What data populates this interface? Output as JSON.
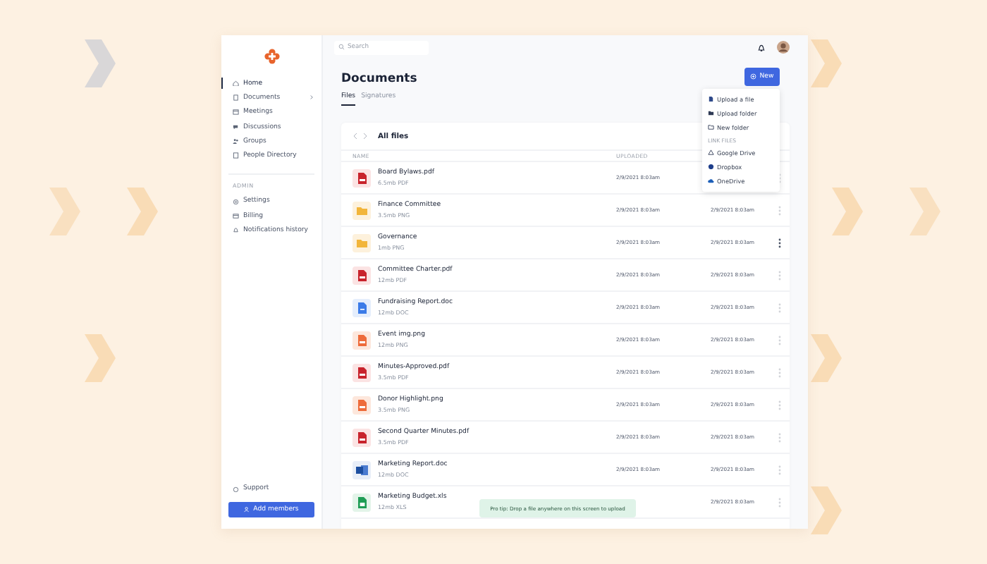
{
  "sidebar": {
    "items": [
      {
        "label": "Home",
        "kind": "home",
        "selected": true,
        "expandable": false
      },
      {
        "label": "Documents",
        "kind": "doc",
        "selected": false,
        "expandable": true
      },
      {
        "label": "Meetings",
        "kind": "calendar",
        "selected": false,
        "expandable": false
      },
      {
        "label": "Discussions",
        "kind": "chat",
        "selected": false,
        "expandable": false
      },
      {
        "label": "Groups",
        "kind": "users",
        "selected": false,
        "expandable": false
      },
      {
        "label": "People Directory",
        "kind": "book",
        "selected": false,
        "expandable": false
      }
    ],
    "section": "ADMIN",
    "admin_items": [
      {
        "label": "Settings",
        "kind": "gear",
        "selected": false
      },
      {
        "label": "Billing",
        "kind": "card",
        "selected": false
      },
      {
        "label": "Notifications history",
        "kind": "bell",
        "selected": false
      }
    ],
    "support": "Support",
    "add_button": "Add members"
  },
  "search": {
    "placeholder": "Search"
  },
  "page_title": "Documents",
  "tabs": [
    {
      "label": "Files",
      "selected": true
    },
    {
      "label": "Signatures",
      "selected": false
    }
  ],
  "new_button": "New",
  "new_menu": {
    "items": [
      {
        "label": "Upload a file",
        "kind": "file"
      },
      {
        "label": "Upload folder",
        "kind": "folder"
      },
      {
        "label": "New folder",
        "kind": "folder-plus"
      }
    ],
    "section": "LINK FILES",
    "links": [
      {
        "label": "Google Drive",
        "kind": "drive"
      },
      {
        "label": "Dropbox",
        "kind": "dropbox"
      },
      {
        "label": "OneDrive",
        "kind": "cloud"
      }
    ]
  },
  "table": {
    "title": "All files",
    "columns": [
      "NAME",
      "UPLOADED"
    ],
    "rows": [
      {
        "name": "Board Bylaws.pdf",
        "meta": "6.5mb PDF",
        "kind": "pdf",
        "uploaded": "2/9/2021 8:03am",
        "hovered": false
      },
      {
        "name": "Finance Committee",
        "meta": "3.5mb PNG",
        "kind": "folder",
        "uploaded": "2/9/2021 8:03am",
        "modified": "2/9/2021 8:03am",
        "hovered": false
      },
      {
        "name": "Governance",
        "meta": "1mb PNG",
        "kind": "folder",
        "uploaded": "2/9/2021 8:03am",
        "modified": "2/9/2021 8:03am",
        "hovered": true
      },
      {
        "name": "Committee Charter.pdf",
        "meta": "12mb PDF",
        "kind": "pdf",
        "uploaded": "2/9/2021 8:03am",
        "modified": "2/9/2021 8:03am",
        "hovered": false
      },
      {
        "name": "Fundraising Report.doc",
        "meta": "12mb DOC",
        "kind": "doc",
        "uploaded": "2/9/2021 8:03am",
        "modified": "2/9/2021 8:03am",
        "hovered": false
      },
      {
        "name": "Event img.png",
        "meta": "12mb PNG",
        "kind": "image",
        "uploaded": "2/9/2021 8:03am",
        "modified": "2/9/2021 8:03am",
        "hovered": false
      },
      {
        "name": "Minutes-Approved.pdf",
        "meta": "3.5mb PDF",
        "kind": "pdf",
        "uploaded": "2/9/2021 8:03am",
        "modified": "2/9/2021 8:03am",
        "hovered": false
      },
      {
        "name": "Donor Highlight.png",
        "meta": "3.5mb PNG",
        "kind": "image",
        "uploaded": "2/9/2021 8:03am",
        "modified": "2/9/2021 8:03am",
        "hovered": false
      },
      {
        "name": "Second Quarter Minutes.pdf",
        "meta": "3.5mb PDF",
        "kind": "pdf",
        "uploaded": "2/9/2021 8:03am",
        "modified": "2/9/2021 8:03am",
        "hovered": false
      },
      {
        "name": "Marketing Report.doc",
        "meta": "12mb DOC",
        "kind": "word",
        "uploaded": "2/9/2021 8:03am",
        "modified": "2/9/2021 8:03am",
        "hovered": false
      },
      {
        "name": "Marketing Budget.xls",
        "meta": "12mb XLS",
        "kind": "sheet",
        "modified": "2/9/2021 8:03am",
        "hovered": false
      }
    ]
  },
  "toast": "Pro tip: Drop a file anywhere on this screen to upload"
}
